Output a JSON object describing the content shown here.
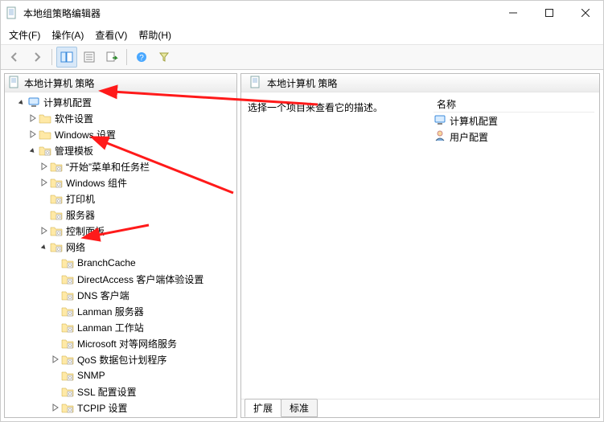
{
  "title": "本地组策略编辑器",
  "menubar": [
    "文件(F)",
    "操作(A)",
    "查看(V)",
    "帮助(H)"
  ],
  "toolbar": {
    "back": "back-icon",
    "forward": "forward-icon",
    "up": "up-icon",
    "showhide": "show-hide-tree-icon",
    "export": "export-list-icon",
    "refresh": "refresh-icon",
    "help": "help-icon",
    "filter": "filter-icon"
  },
  "tree_root": "本地计算机 策略",
  "tree": [
    {
      "id": "root",
      "depth": 0,
      "expander": "open",
      "icon": "policy",
      "label": "本地计算机 策略"
    },
    {
      "id": "comp",
      "depth": 1,
      "expander": "open",
      "icon": "computer",
      "label": "计算机配置"
    },
    {
      "id": "soft",
      "depth": 2,
      "expander": "closed",
      "icon": "folder",
      "label": "软件设置"
    },
    {
      "id": "winset",
      "depth": 2,
      "expander": "closed",
      "icon": "folder",
      "label": "Windows 设置"
    },
    {
      "id": "admtpl",
      "depth": 2,
      "expander": "open",
      "icon": "folder-cfg",
      "label": "管理模板"
    },
    {
      "id": "start",
      "depth": 3,
      "expander": "closed",
      "icon": "folder-cfg",
      "label": "“开始”菜单和任务栏"
    },
    {
      "id": "wincomp",
      "depth": 3,
      "expander": "closed",
      "icon": "folder-cfg",
      "label": "Windows 组件"
    },
    {
      "id": "printer",
      "depth": 3,
      "expander": "none",
      "icon": "folder-cfg",
      "label": "打印机"
    },
    {
      "id": "server",
      "depth": 3,
      "expander": "none",
      "icon": "folder-cfg",
      "label": "服务器"
    },
    {
      "id": "ctrlpnl",
      "depth": 3,
      "expander": "closed",
      "icon": "folder-cfg",
      "label": "控制面板"
    },
    {
      "id": "network",
      "depth": 3,
      "expander": "open",
      "icon": "folder-cfg",
      "label": "网络"
    },
    {
      "id": "bc",
      "depth": 4,
      "expander": "none",
      "icon": "folder-cfg",
      "label": "BranchCache"
    },
    {
      "id": "da",
      "depth": 4,
      "expander": "none",
      "icon": "folder-cfg",
      "label": "DirectAccess 客户端体验设置"
    },
    {
      "id": "dns",
      "depth": 4,
      "expander": "none",
      "icon": "folder-cfg",
      "label": "DNS 客户端"
    },
    {
      "id": "lans",
      "depth": 4,
      "expander": "none",
      "icon": "folder-cfg",
      "label": "Lanman 服务器"
    },
    {
      "id": "lanw",
      "depth": 4,
      "expander": "none",
      "icon": "folder-cfg",
      "label": "Lanman 工作站"
    },
    {
      "id": "msp2p",
      "depth": 4,
      "expander": "none",
      "icon": "folder-cfg",
      "label": "Microsoft 对等网络服务"
    },
    {
      "id": "qos",
      "depth": 4,
      "expander": "closed",
      "icon": "folder-cfg",
      "label": "QoS 数据包计划程序"
    },
    {
      "id": "snmp",
      "depth": 4,
      "expander": "none",
      "icon": "folder-cfg",
      "label": "SNMP"
    },
    {
      "id": "ssl",
      "depth": 4,
      "expander": "none",
      "icon": "folder-cfg",
      "label": "SSL 配置设置"
    },
    {
      "id": "tcpip",
      "depth": 4,
      "expander": "closed",
      "icon": "folder-cfg",
      "label": "TCPIP 设置"
    }
  ],
  "right": {
    "header": "本地计算机 策略",
    "description": "选择一个项目来查看它的描述。",
    "column_name": "名称",
    "items": [
      {
        "icon": "computer",
        "label": "计算机配置"
      },
      {
        "icon": "user",
        "label": "用户配置"
      }
    ]
  },
  "tabs": {
    "extended": "扩展",
    "standard": "标准"
  }
}
